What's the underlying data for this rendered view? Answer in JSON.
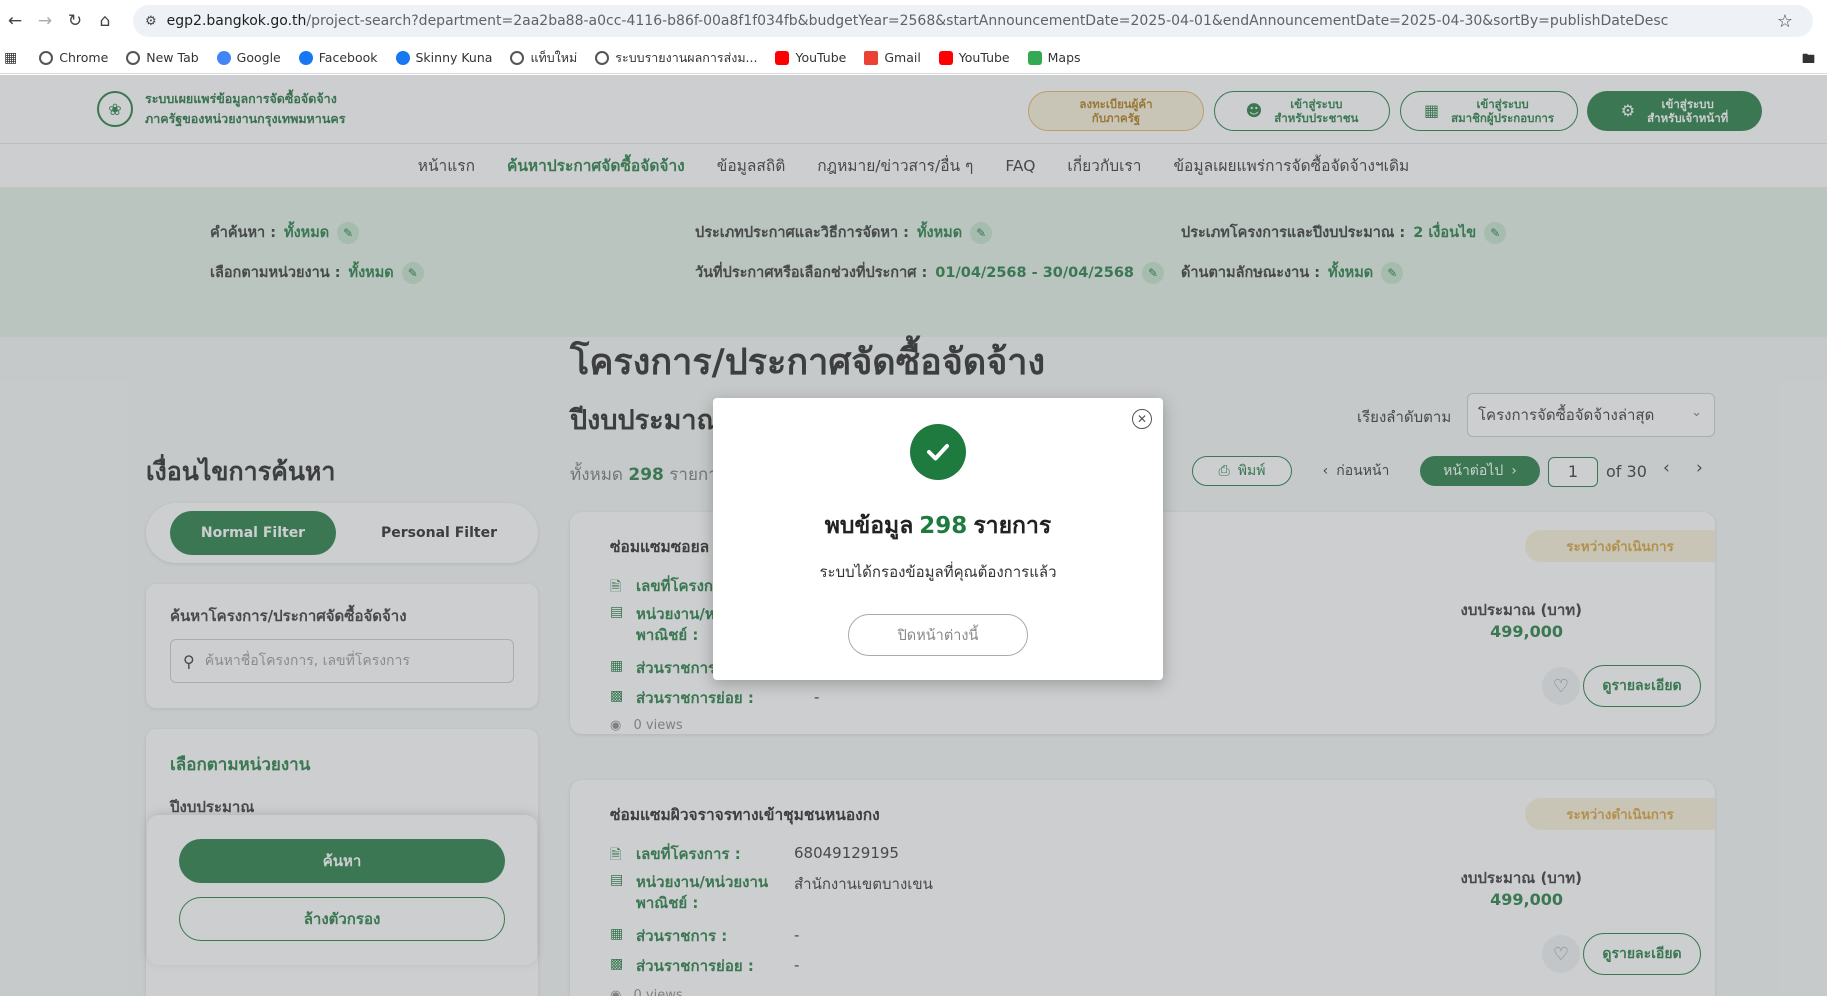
{
  "browser": {
    "url_host": "egp2.bangkok.go.th",
    "url_path": "/project-search?department=2aa2ba88-a0cc-4116-b86f-00a8f1f034fb&budgetYear=2568&startAnnouncementDate=2025-04-01&endAnnouncementDate=2025-04-30&sortBy=publishDateDesc",
    "bookmarks": [
      {
        "label": "Chrome",
        "color": "#555555"
      },
      {
        "label": "New Tab",
        "color": "#555555"
      },
      {
        "label": "Google",
        "color": "#4285f4"
      },
      {
        "label": "Facebook",
        "color": "#1877f2"
      },
      {
        "label": "Skinny Kuna",
        "color": "#1877f2"
      },
      {
        "label": "แท็บใหม่",
        "color": "#555555"
      },
      {
        "label": "ระบบรายงานผลการส่งม...",
        "color": "#555555"
      },
      {
        "label": "YouTube",
        "color": "#ff0000"
      },
      {
        "label": "Gmail",
        "color": "#ea4335"
      },
      {
        "label": "YouTube",
        "color": "#ff0000"
      },
      {
        "label": "Maps",
        "color": "#34a853"
      }
    ]
  },
  "header": {
    "logo_line1": "ระบบเผยแพร่ข้อมูลการจัดซื้อจัดจ้าง",
    "logo_line2": "ภาครัฐของหน่วยงานกรุงเทพมหานคร",
    "register_line1": "ลงทะเบียนผู้ค้า",
    "register_line2": "กับภาครัฐ",
    "public_line1": "เข้าสู่ระบบ",
    "public_line2": "สำหรับประชาชน",
    "member_line1": "เข้าสู่ระบบ",
    "member_line2": "สมาชิกผู้ประกอบการ",
    "staff_line1": "เข้าสู่ระบบ",
    "staff_line2": "สำหรับเจ้าหน้าที่"
  },
  "nav": [
    "หน้าแรก",
    "ค้นหาประกาศจัดซื้อจัดจ้าง",
    "ข้อมูลสถิติ",
    "กฎหมาย/ข่าวสาร/อื่น ๆ",
    "FAQ",
    "เกี่ยวกับเรา",
    "ข้อมูลเผยแพร่การจัดซื้อจัดจ้างฯเดิม"
  ],
  "criteria": {
    "keyword_label": "คำค้นหา :",
    "keyword_value": "ทั้งหมด",
    "unit_label": "เลือกตามหน่วยงาน :",
    "unit_value": "ทั้งหมด",
    "type_label": "ประเภทประกาศและวิธีการจัดหา :",
    "type_value": "ทั้งหมด",
    "date_label": "วันที่ประกาศหรือเลือกช่วงที่ประกาศ :",
    "date_value": "01/04/2568 - 30/04/2568",
    "project_label": "ประเภทโครงการและปีงบประมาณ :",
    "project_value": "2 เงื่อนไข",
    "nature_label": "ด้านตามลักษณะงาน :",
    "nature_value": "ทั้งหมด"
  },
  "main": {
    "title": "โครงการ/ประกาศจัดซื้อจัดจ้าง",
    "subtitle": "ปีงบประมาณ",
    "total_prefix": "ทั้งหมด",
    "total_count": "298",
    "total_suffix": "รายการ",
    "sort_label": "เรียงลำดับตาม",
    "sort_value": "โครงการจัดซื้อจัดจ้างล่าสุด",
    "print_label": "พิมพ์",
    "prev_label": "ก่อนหน้า",
    "next_label": "หน้าต่อไป",
    "page_current": "1",
    "page_of": "of 30"
  },
  "sidebar": {
    "title": "เงื่อนไขการค้นหา",
    "normal_filter": "Normal Filter",
    "personal_filter": "Personal Filter",
    "search_title": "ค้นหาโครงการ/ประกาศจัดซื้อจัดจ้าง",
    "search_placeholder": "ค้นหาชื่อโครงการ, เลขที่โครงการ",
    "unit_title": "เลือกตามหน่วยงาน",
    "budget_year_label": "ปีงบประมาณ",
    "search_button": "ค้นหา",
    "clear_button": "ล้างตัวกรอง"
  },
  "projects": [
    {
      "name": "ซ่อมแซมซอยล",
      "status": "ระหว่างดำเนินการ",
      "label_number": "เลขที่โครงก",
      "label_unit_line1": "หน่วยงาน/ห",
      "label_unit_line2": "พาณิชย์ :",
      "label_division": "ส่วนราชการ",
      "label_subdivision": "ส่วนราชการย่อย :",
      "subdivision": "-",
      "views": "0 views",
      "budget_label": "งบประมาณ (บาท)",
      "budget": "499,000",
      "detail_button": "ดูรายละเอียด"
    },
    {
      "name": "ซ่อมแซมผิวจราจรทางเข้าชุมชนหนองกง",
      "status": "ระหว่างดำเนินการ",
      "label_number": "เลขที่โครงการ :",
      "number": "68049129195",
      "label_unit_line1": "หน่วยงาน/หน่วยงาน",
      "label_unit_line2": "พาณิชย์ :",
      "unit": "สำนักงานเขตบางเขน",
      "label_division": "ส่วนราชการ :",
      "division": "-",
      "label_subdivision": "ส่วนราชการย่อย :",
      "subdivision": "-",
      "views": "0 views",
      "budget_label": "งบประมาณ (บาท)",
      "budget": "499,000",
      "detail_button": "ดูรายละเอียด"
    }
  ],
  "modal": {
    "title_prefix": "พบข้อมูล",
    "count": "298",
    "title_suffix": "รายการ",
    "description": "ระบบได้กรองข้อมูลที่คุณต้องการแล้ว",
    "close_button": "ปิดหน้าต่างนี้"
  },
  "colors": {
    "primary": "#1f7a3f",
    "status": "#d8a23a"
  }
}
